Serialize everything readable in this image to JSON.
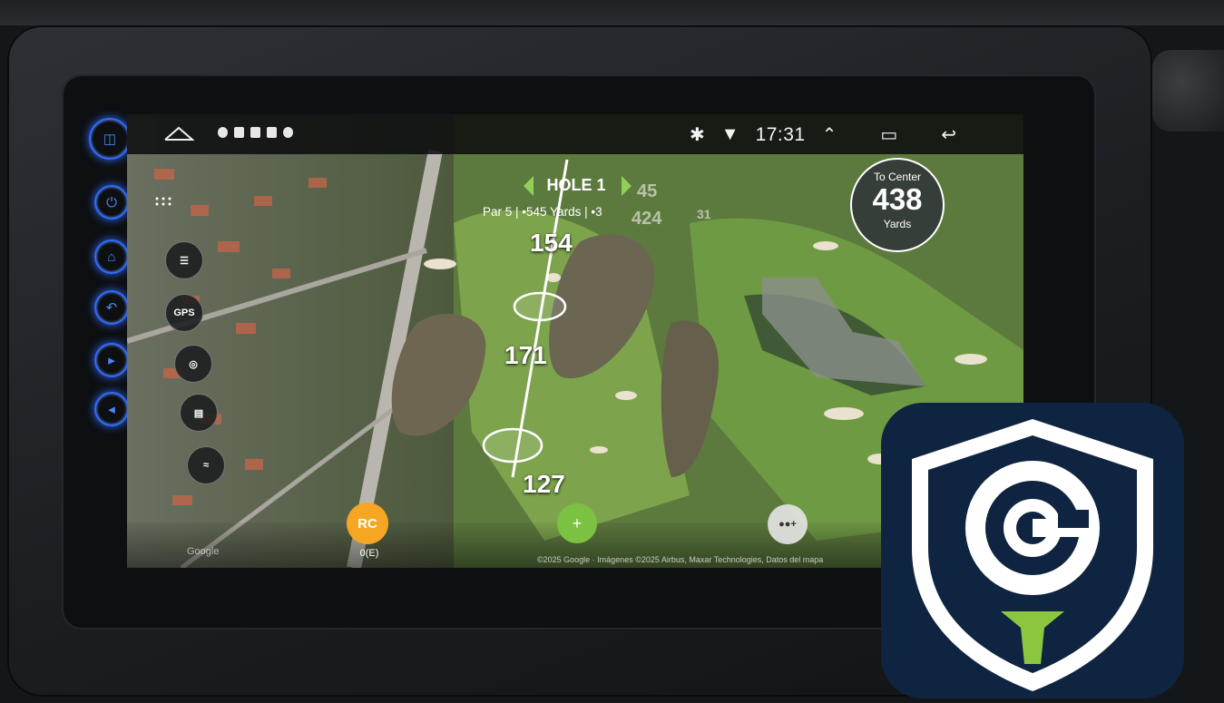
{
  "statusbar": {
    "time": "17:31",
    "icons": [
      "home-icon",
      "location-icon",
      "notification-icons",
      "bluetooth-icon",
      "wifi-icon",
      "chevron-up-icon",
      "recent-apps-icon",
      "back-icon"
    ]
  },
  "hole": {
    "title": "HOLE 1",
    "par": "Par 5",
    "yards": "545 Yards",
    "handicap": "3",
    "prev_label": "45",
    "next_label": "424",
    "extra_label": "31"
  },
  "to_center": {
    "label": "To Center",
    "value": "438",
    "unit": "Yards"
  },
  "distances": {
    "d1": "154",
    "d2": "171",
    "d3": "127"
  },
  "left_tools": {
    "gps_label": "GPS"
  },
  "bottom": {
    "rc_label": "RC",
    "rc_value": "0(E)",
    "plus_label": "+",
    "map_copyright": "©2025 Google · Imágenes ©2025 Airbus, Maxar Technologies, Datos del mapa",
    "google_label": "Google"
  },
  "colors": {
    "accent_green": "#7cc242",
    "rc_orange": "#f5a623",
    "side_button_blue": "#2f6bff",
    "logo_navy": "#0f2440"
  }
}
